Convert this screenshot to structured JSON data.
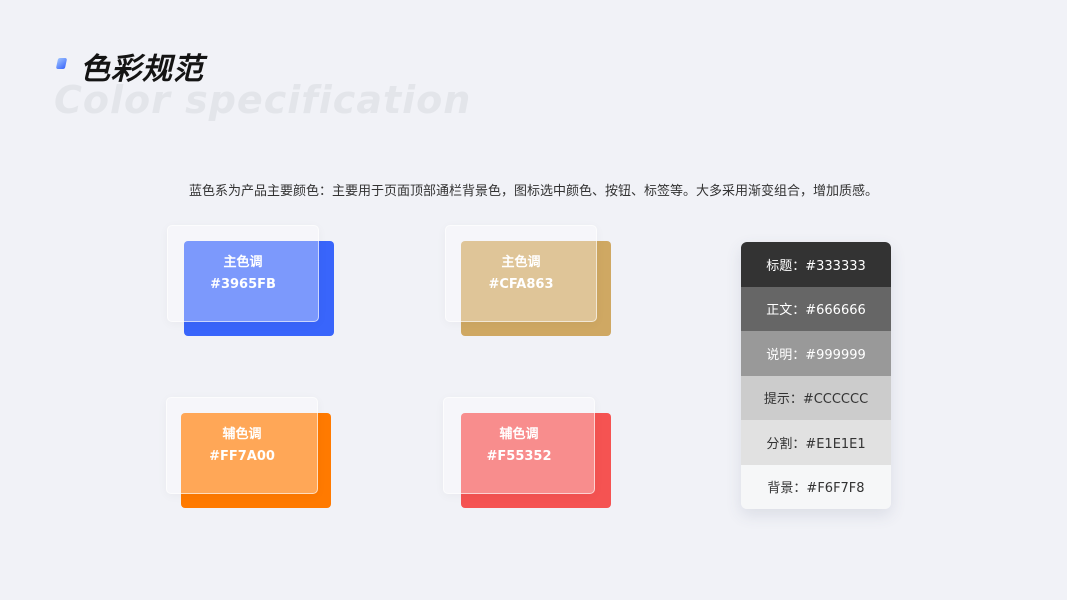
{
  "header": {
    "title_cn": "色彩规范",
    "title_en": "Color specification"
  },
  "description": "蓝色系为产品主要颜色：主要用于页面顶部通栏背景色，图标选中颜色、按钮、标签等。大多采用渐变组合，增加质感。",
  "swatches": [
    {
      "label": "主色调",
      "hex": "#3965FB",
      "color": "#3965FB"
    },
    {
      "label": "主色调",
      "hex": "#CFA863",
      "color": "#CFA863"
    },
    {
      "label": "辅色调",
      "hex": "#FF7A00",
      "color": "#FF7A00"
    },
    {
      "label": "辅色调",
      "hex": "#F55352",
      "color": "#F55352"
    }
  ],
  "neutrals": [
    {
      "text": "标题：#333333",
      "bg": "#333333",
      "fg": "#FFFFFF"
    },
    {
      "text": "正文：#666666",
      "bg": "#666666",
      "fg": "#FFFFFF"
    },
    {
      "text": "说明：#999999",
      "bg": "#999999",
      "fg": "#FFFFFF"
    },
    {
      "text": "提示：#CCCCCC",
      "bg": "#CCCCCC",
      "fg": "#333333"
    },
    {
      "text": "分割：#E1E1E1",
      "bg": "#E1E1E1",
      "fg": "#333333"
    },
    {
      "text": "背景：#F6F7F8",
      "bg": "#F6F7F8",
      "fg": "#333333"
    }
  ]
}
